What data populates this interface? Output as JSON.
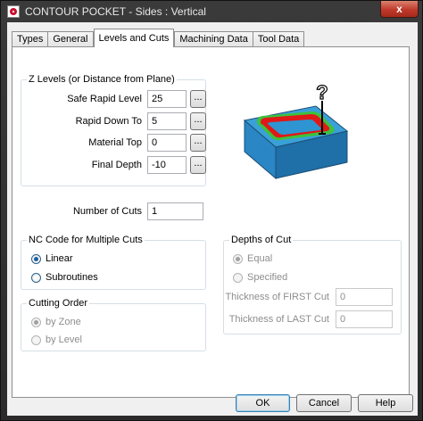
{
  "window": {
    "title": "CONTOUR POCKET - Sides : Vertical",
    "close_glyph": "x"
  },
  "tabs": [
    {
      "label": "Types"
    },
    {
      "label": "General"
    },
    {
      "label": "Levels and Cuts"
    },
    {
      "label": "Machining Data"
    },
    {
      "label": "Tool Data"
    }
  ],
  "active_tab": "Levels and Cuts",
  "z_levels": {
    "legend": "Z Levels (or Distance from Plane)",
    "safe_rapid": {
      "label": "Safe Rapid Level",
      "value": "25"
    },
    "rapid_down": {
      "label": "Rapid Down To",
      "value": "5"
    },
    "material_top": {
      "label": "Material Top",
      "value": "0"
    },
    "final_depth": {
      "label": "Final Depth",
      "value": "-10"
    },
    "browse_label": "..."
  },
  "cuts": {
    "label": "Number of Cuts",
    "value": "1"
  },
  "nc_code": {
    "legend": "NC Code for Multiple Cuts",
    "linear": "Linear",
    "subroutines": "Subroutines",
    "selected": "linear"
  },
  "cutting_order": {
    "legend": "Cutting Order",
    "by_zone": "by Zone",
    "by_level": "by Level",
    "selected": "by_zone"
  },
  "depths": {
    "legend": "Depths of Cut",
    "equal": "Equal",
    "specified": "Specified",
    "selected": "equal",
    "first_cut": {
      "label": "Thickness of FIRST Cut",
      "value": "0"
    },
    "last_cut": {
      "label": "Thickness of LAST Cut",
      "value": "0"
    }
  },
  "preview": {
    "help_glyph": "?"
  },
  "buttons": {
    "ok": "OK",
    "cancel": "Cancel",
    "help": "Help"
  },
  "colors": {
    "block_top": "#3aa0d8",
    "block_side": "#1f6fa8",
    "pocket_wall": "#e01818",
    "pocket_outline": "#3cc23c"
  }
}
